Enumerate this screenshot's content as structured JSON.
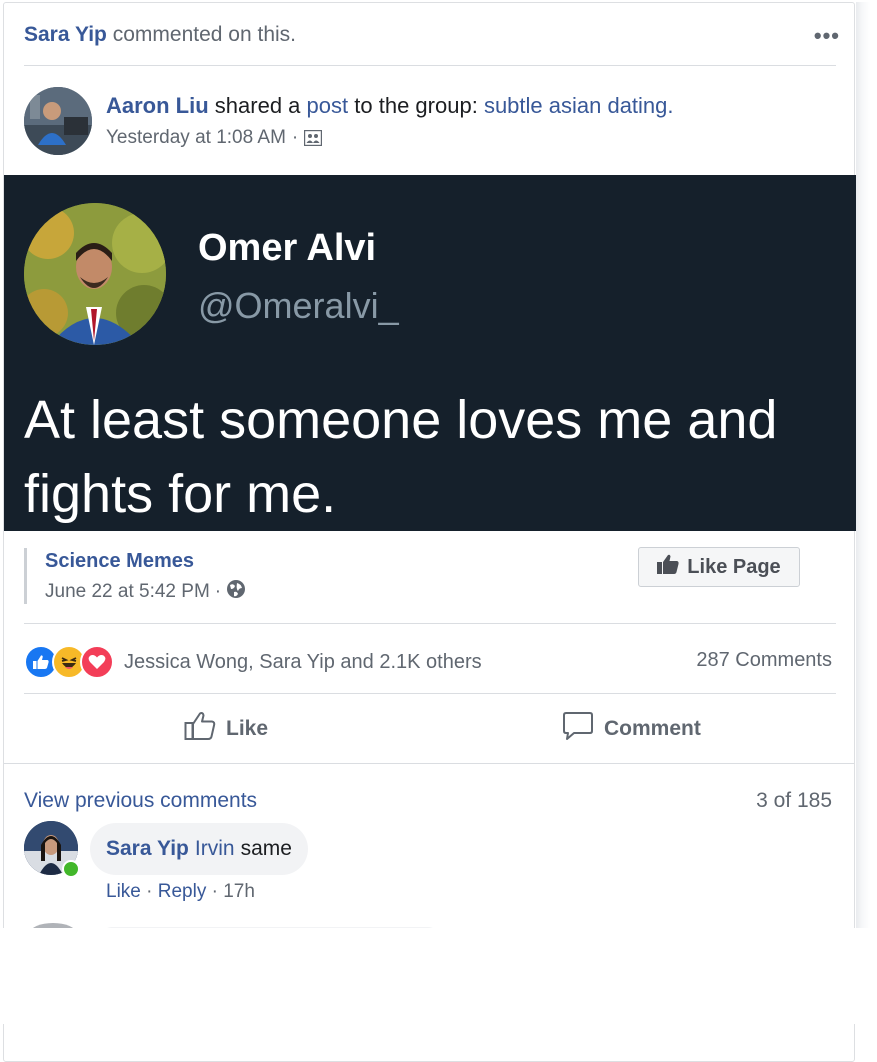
{
  "story": {
    "actor": "Sara Yip",
    "action": "commented on this.",
    "more_icon": "more-dots-icon"
  },
  "post": {
    "author": "Aaron Liu",
    "shared_text": "shared a",
    "post_link": "post",
    "to_group_text": "to the group:",
    "group_name": "subtle asian dating.",
    "timestamp": "Yesterday at 1:08 AM",
    "separator": "·",
    "privacy_icon": "group-icon"
  },
  "shared_image": {
    "name": "Omer Alvi",
    "handle": "@Omeralvi_",
    "text": "At least someone loves me and fights for me."
  },
  "attribution": {
    "page_name": "Science Memes",
    "date": "June 22 at 5:42 PM",
    "separator": "·",
    "privacy_icon": "globe-icon",
    "like_page_label": "Like Page"
  },
  "reactions": {
    "icons": [
      "like-reaction-icon",
      "haha-reaction-icon",
      "love-reaction-icon"
    ],
    "summary": "Jessica Wong, Sara Yip and 2.1K others",
    "comments_count": "287 Comments"
  },
  "actions": {
    "like": "Like",
    "comment": "Comment"
  },
  "comments": {
    "view_previous": "View previous comments",
    "pagination": "3 of 185",
    "items": [
      {
        "author": "Sara Yip",
        "mention": "Irvin",
        "text": "same",
        "like": "Like",
        "reply": "Reply",
        "time": "17h",
        "separator": "·"
      }
    ]
  },
  "colors": {
    "link": "#385898",
    "muted": "#606770",
    "tweet_bg": "#15202b",
    "like_blue": "#1877f2",
    "online": "#42b72a"
  }
}
